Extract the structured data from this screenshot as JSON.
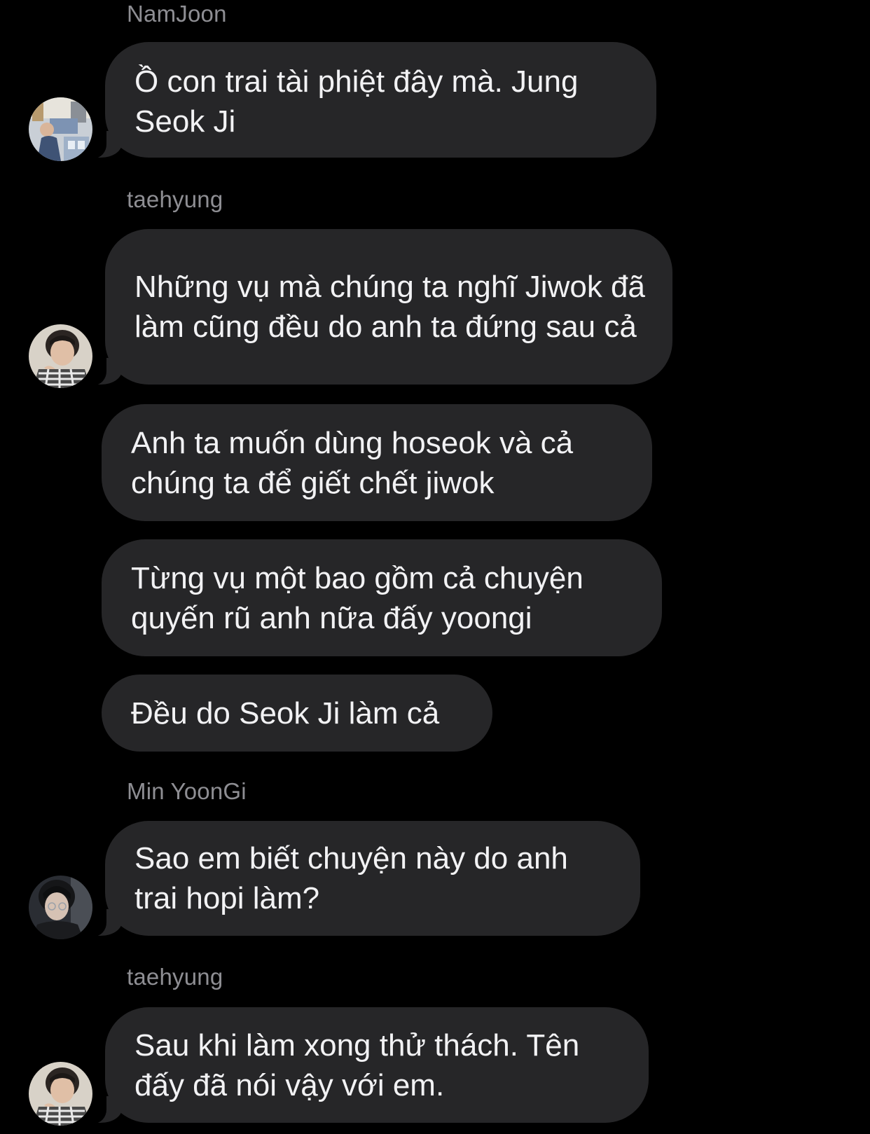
{
  "colors": {
    "background": "#000000",
    "bubble": "#262628",
    "message_text": "#f2f2f4",
    "sender_name": "#8e8e93"
  },
  "messages": [
    {
      "sender": "NamJoon",
      "avatar": "namjoon-avatar",
      "bubbles": [
        "Ồ con trai tài phiệt đây mà. Jung Seok Ji"
      ]
    },
    {
      "sender": "taehyung",
      "avatar": "taehyung-avatar",
      "bubbles": [
        "Những vụ mà chúng ta nghĩ Jiwok đã làm cũng đều do anh ta đứng sau cả",
        "Anh ta muốn dùng hoseok và cả chúng ta để giết chết jiwok",
        "Từng vụ một bao gồm cả chuyện quyến rũ anh nữa đấy yoongi",
        "Đều do Seok Ji làm cả"
      ]
    },
    {
      "sender": "Min YoonGi",
      "avatar": "yoongi-avatar",
      "bubbles": [
        "Sao em biết chuyện này do anh trai hopi làm?"
      ]
    },
    {
      "sender": "taehyung",
      "avatar": "taehyung-avatar",
      "bubbles": [
        "Sau khi làm xong thử thách. Tên đấy đã nói vậy với em."
      ]
    }
  ]
}
